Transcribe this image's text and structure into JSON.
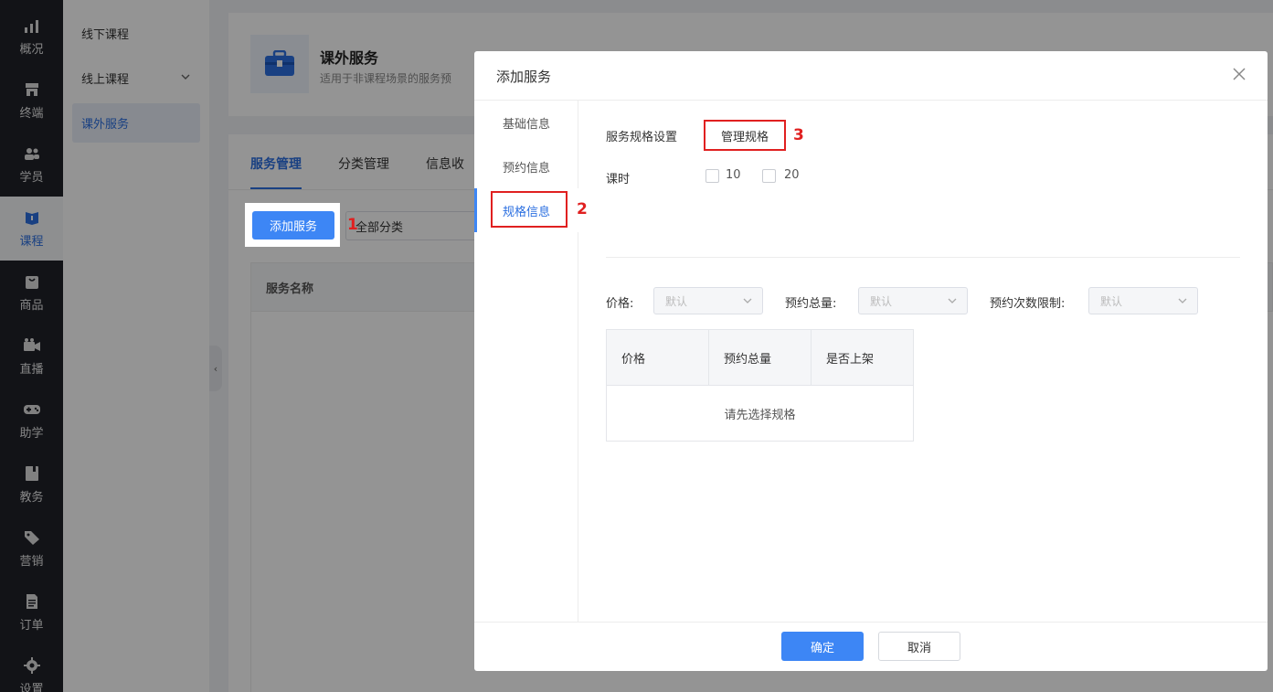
{
  "nav": {
    "items": [
      {
        "label": "概况",
        "icon": "chart-icon"
      },
      {
        "label": "终端",
        "icon": "store-icon"
      },
      {
        "label": "学员",
        "icon": "users-icon"
      },
      {
        "label": "课程",
        "icon": "book-icon"
      },
      {
        "label": "商品",
        "icon": "bag-icon"
      },
      {
        "label": "直播",
        "icon": "video-icon"
      },
      {
        "label": "助学",
        "icon": "gamepad-icon"
      },
      {
        "label": "教务",
        "icon": "notebook-icon"
      },
      {
        "label": "营销",
        "icon": "tag-icon"
      },
      {
        "label": "订单",
        "icon": "document-icon"
      },
      {
        "label": "设置",
        "icon": "gear-icon"
      }
    ],
    "active_index": 3
  },
  "subnav": {
    "items": [
      "线下课程",
      "线上课程",
      "课外服务"
    ]
  },
  "header": {
    "title": "课外服务",
    "desc": "适用于非课程场景的服务预"
  },
  "page": {
    "tabs": [
      "服务管理",
      "分类管理",
      "信息收"
    ],
    "add_button": "添加服务",
    "category_select": "全部分类",
    "table_col": "服务名称"
  },
  "annotations": [
    "1",
    "2",
    "3"
  ],
  "dialog": {
    "title": "添加服务",
    "side": [
      "基础信息",
      "预约信息",
      "规格信息"
    ],
    "spec_setting_label": "服务规格设置",
    "manage_button": "管理规格",
    "hours_label": "课时",
    "hour_options": [
      "10",
      "20"
    ],
    "filters": [
      {
        "label": "价格:",
        "value": "默认"
      },
      {
        "label": "预约总量:",
        "value": "默认"
      },
      {
        "label": "预约次数限制:",
        "value": "默认"
      }
    ],
    "table_headers": [
      "价格",
      "预约总量",
      "是否上架"
    ],
    "table_empty": "请先选择规格",
    "ok": "确定",
    "cancel": "取消"
  },
  "colors": {
    "accent": "#3d86f5",
    "nav_bg": "#1f2129",
    "annotation": "#e02020"
  }
}
